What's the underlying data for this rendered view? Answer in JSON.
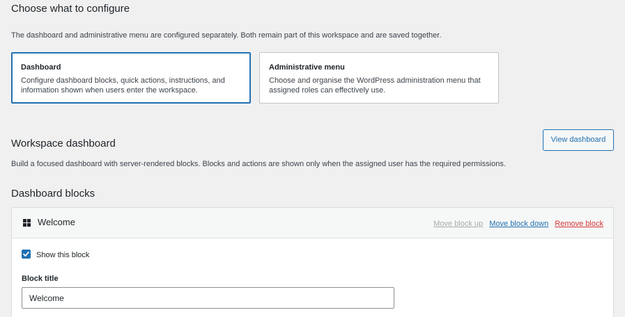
{
  "configure": {
    "heading": "Choose what to configure",
    "description": "The dashboard and administrative menu are configured separately. Both remain part of this workspace and are saved together.",
    "options": [
      {
        "title": "Dashboard",
        "description": "Configure dashboard blocks, quick actions, instructions, and information shown when users enter the workspace.",
        "selected": true
      },
      {
        "title": "Administrative menu",
        "description": "Choose and organise the WordPress administration menu that assigned roles can effectively use.",
        "selected": false
      }
    ]
  },
  "workspace": {
    "heading": "Workspace dashboard",
    "view_button": "View dashboard",
    "description": "Build a focused dashboard with server-rendered blocks. Blocks and actions are shown only when the assigned user has the required permissions."
  },
  "blocks": {
    "heading": "Dashboard blocks",
    "items": [
      {
        "name": "Welcome",
        "icon": "grid-icon",
        "actions": {
          "move_up": "Move block up",
          "move_down": "Move block down",
          "remove": "Remove block"
        },
        "show_label": "Show this block",
        "show_checked": true,
        "title_label": "Block title",
        "title_value": "Welcome"
      }
    ]
  },
  "colors": {
    "accent": "#2271b1",
    "danger": "#d63638",
    "disabled": "#a7aaad",
    "background": "#f0f0f1"
  }
}
